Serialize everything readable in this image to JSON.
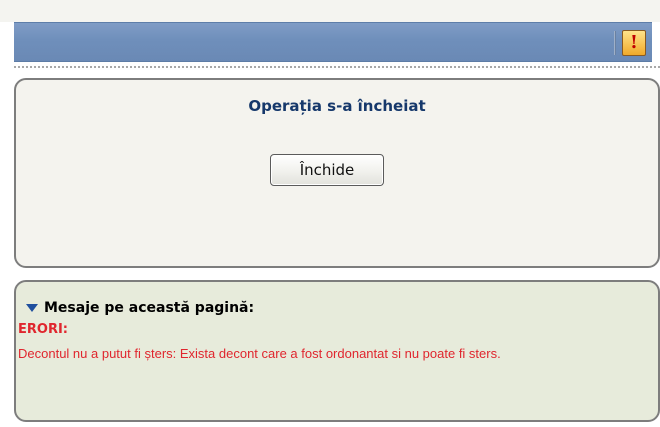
{
  "header": {
    "alert_icon": "exclamation-icon",
    "alert_glyph": "!"
  },
  "dialog": {
    "title": "Operația s-a încheiat",
    "close_button": "Închide"
  },
  "messages": {
    "heading": "Mesaje pe această pagină:",
    "errors_label": "ERORI:",
    "error_text": "Decontul nu a putut fi șters: Exista decont care a fost ordonantat si nu poate fi sters."
  },
  "colors": {
    "titlebar": "#7393bf",
    "panel_bg": "#f4f3ee",
    "message_bg": "#e7ebdb",
    "error": "#e0262e",
    "title_text": "#16386b"
  }
}
